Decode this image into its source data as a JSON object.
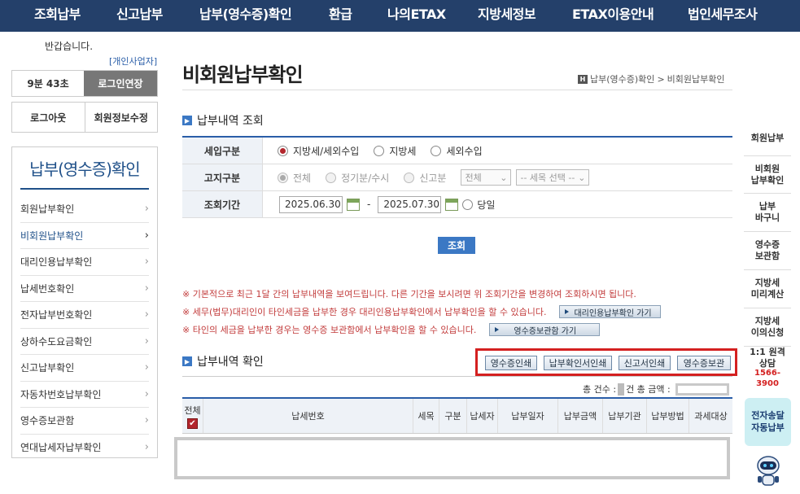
{
  "topnav": [
    "조회납부",
    "신고납부",
    "납부(영수증)확인",
    "환급",
    "나의ETAX",
    "지방세정보",
    "ETAX이용안내",
    "법인세무조사"
  ],
  "user": {
    "greeting": "반갑습니다.",
    "biz_type": "[개인사업자]",
    "session_time": "9분 43초",
    "extend_login": "로그인연장",
    "logout": "로그아웃",
    "edit_info": "회원정보수정"
  },
  "sidebar": {
    "title": "납부(영수증)확인",
    "items": [
      "회원납부확인",
      "비회원납부확인",
      "대리인용납부확인",
      "납세번호확인",
      "전자납부번호확인",
      "상하수도요금확인",
      "신고납부확인",
      "자동차번호납부확인",
      "영수증보관함",
      "연대납세자납부확인"
    ]
  },
  "page": {
    "title": "비회원납부확인",
    "breadcrumb": [
      "H",
      "납부(영수증)확인",
      ">",
      "비회원납부확인"
    ]
  },
  "search_section": {
    "title": "납부내역 조회",
    "rows": {
      "income_type": {
        "label": "세입구분",
        "options": [
          "지방세/세외수입",
          "지방세",
          "세외수입"
        ],
        "selected": "지방세/세외수입"
      },
      "notice_type": {
        "label": "고지구분",
        "options": [
          "전체",
          "정기분/수시",
          "신고분"
        ],
        "selected": "전체",
        "select1": "전체",
        "select2": "-- 세목 선택 --"
      },
      "period": {
        "label": "조회기간",
        "from": "2025.06.30",
        "separator": "-",
        "to": "2025.07.30",
        "today": "당일"
      }
    },
    "search_button": "조회"
  },
  "notes": [
    {
      "text": "※ 기본적으로 최근 1달 간의 납부내역을 보여드립니다. 다른 기간을 보시려면 위 조회기간을 변경하여 조회하시면 됩니다.",
      "button": ""
    },
    {
      "text": "※ 세무(법무)대리인이 타인세금을 납부한 경우 대리인용납부확인에서 납부확인을 할 수 있습니다.",
      "button": "대리인용납부확인 가기"
    },
    {
      "text": "※ 타인의 세금을 납부한 경우는 영수증 보관함에서 납부확인을 할 수 있습니다.",
      "button": "영수증보관함 가기"
    }
  ],
  "result_section": {
    "title": "납부내역 확인",
    "actions": [
      "영수증인쇄",
      "납부확인서인쇄",
      "신고서인쇄",
      "영수증보관"
    ],
    "total_count_label": "총 건수 :",
    "total_amount_label": "건 총 금액 :",
    "columns": [
      "전체",
      "납세번호",
      "세목",
      "구분",
      "납세자",
      "납부일자",
      "납부금액",
      "납부기관",
      "납부방법",
      "과세대상"
    ]
  },
  "quick_menu": {
    "items": [
      "회원납부",
      "비회원\n납부확인",
      "납부\n바구니",
      "영수증\n보관함",
      "지방세\n미리계산",
      "지방세\n이의신청"
    ],
    "cs_title": "1:1 원격\n상담",
    "cs_phone": "1566-3900",
    "auto_pay": "전자송달\n자동납부"
  }
}
